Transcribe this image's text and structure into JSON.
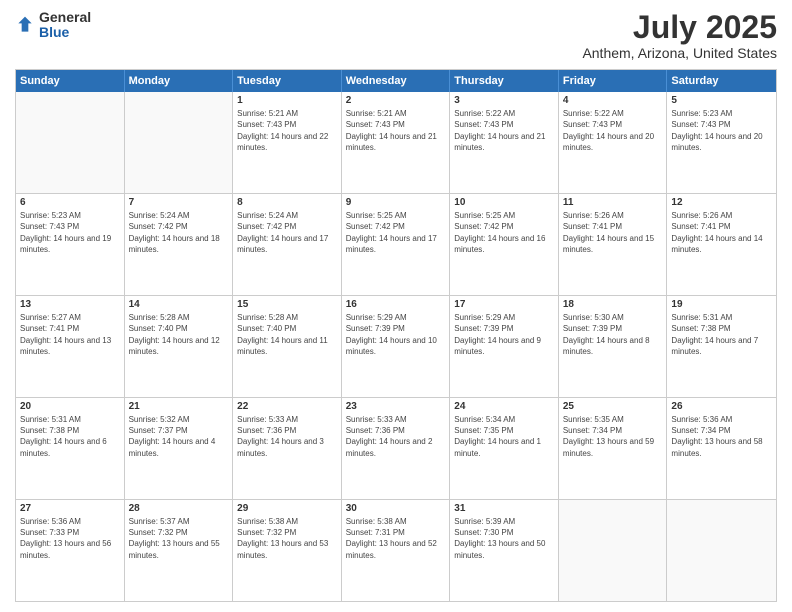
{
  "logo": {
    "general": "General",
    "blue": "Blue"
  },
  "title": "July 2025",
  "subtitle": "Anthem, Arizona, United States",
  "headers": [
    "Sunday",
    "Monday",
    "Tuesday",
    "Wednesday",
    "Thursday",
    "Friday",
    "Saturday"
  ],
  "weeks": [
    [
      {
        "day": "",
        "detail": ""
      },
      {
        "day": "",
        "detail": ""
      },
      {
        "day": "1",
        "detail": "Sunrise: 5:21 AM\nSunset: 7:43 PM\nDaylight: 14 hours and 22 minutes."
      },
      {
        "day": "2",
        "detail": "Sunrise: 5:21 AM\nSunset: 7:43 PM\nDaylight: 14 hours and 21 minutes."
      },
      {
        "day": "3",
        "detail": "Sunrise: 5:22 AM\nSunset: 7:43 PM\nDaylight: 14 hours and 21 minutes."
      },
      {
        "day": "4",
        "detail": "Sunrise: 5:22 AM\nSunset: 7:43 PM\nDaylight: 14 hours and 20 minutes."
      },
      {
        "day": "5",
        "detail": "Sunrise: 5:23 AM\nSunset: 7:43 PM\nDaylight: 14 hours and 20 minutes."
      }
    ],
    [
      {
        "day": "6",
        "detail": "Sunrise: 5:23 AM\nSunset: 7:43 PM\nDaylight: 14 hours and 19 minutes."
      },
      {
        "day": "7",
        "detail": "Sunrise: 5:24 AM\nSunset: 7:42 PM\nDaylight: 14 hours and 18 minutes."
      },
      {
        "day": "8",
        "detail": "Sunrise: 5:24 AM\nSunset: 7:42 PM\nDaylight: 14 hours and 17 minutes."
      },
      {
        "day": "9",
        "detail": "Sunrise: 5:25 AM\nSunset: 7:42 PM\nDaylight: 14 hours and 17 minutes."
      },
      {
        "day": "10",
        "detail": "Sunrise: 5:25 AM\nSunset: 7:42 PM\nDaylight: 14 hours and 16 minutes."
      },
      {
        "day": "11",
        "detail": "Sunrise: 5:26 AM\nSunset: 7:41 PM\nDaylight: 14 hours and 15 minutes."
      },
      {
        "day": "12",
        "detail": "Sunrise: 5:26 AM\nSunset: 7:41 PM\nDaylight: 14 hours and 14 minutes."
      }
    ],
    [
      {
        "day": "13",
        "detail": "Sunrise: 5:27 AM\nSunset: 7:41 PM\nDaylight: 14 hours and 13 minutes."
      },
      {
        "day": "14",
        "detail": "Sunrise: 5:28 AM\nSunset: 7:40 PM\nDaylight: 14 hours and 12 minutes."
      },
      {
        "day": "15",
        "detail": "Sunrise: 5:28 AM\nSunset: 7:40 PM\nDaylight: 14 hours and 11 minutes."
      },
      {
        "day": "16",
        "detail": "Sunrise: 5:29 AM\nSunset: 7:39 PM\nDaylight: 14 hours and 10 minutes."
      },
      {
        "day": "17",
        "detail": "Sunrise: 5:29 AM\nSunset: 7:39 PM\nDaylight: 14 hours and 9 minutes."
      },
      {
        "day": "18",
        "detail": "Sunrise: 5:30 AM\nSunset: 7:39 PM\nDaylight: 14 hours and 8 minutes."
      },
      {
        "day": "19",
        "detail": "Sunrise: 5:31 AM\nSunset: 7:38 PM\nDaylight: 14 hours and 7 minutes."
      }
    ],
    [
      {
        "day": "20",
        "detail": "Sunrise: 5:31 AM\nSunset: 7:38 PM\nDaylight: 14 hours and 6 minutes."
      },
      {
        "day": "21",
        "detail": "Sunrise: 5:32 AM\nSunset: 7:37 PM\nDaylight: 14 hours and 4 minutes."
      },
      {
        "day": "22",
        "detail": "Sunrise: 5:33 AM\nSunset: 7:36 PM\nDaylight: 14 hours and 3 minutes."
      },
      {
        "day": "23",
        "detail": "Sunrise: 5:33 AM\nSunset: 7:36 PM\nDaylight: 14 hours and 2 minutes."
      },
      {
        "day": "24",
        "detail": "Sunrise: 5:34 AM\nSunset: 7:35 PM\nDaylight: 14 hours and 1 minute."
      },
      {
        "day": "25",
        "detail": "Sunrise: 5:35 AM\nSunset: 7:34 PM\nDaylight: 13 hours and 59 minutes."
      },
      {
        "day": "26",
        "detail": "Sunrise: 5:36 AM\nSunset: 7:34 PM\nDaylight: 13 hours and 58 minutes."
      }
    ],
    [
      {
        "day": "27",
        "detail": "Sunrise: 5:36 AM\nSunset: 7:33 PM\nDaylight: 13 hours and 56 minutes."
      },
      {
        "day": "28",
        "detail": "Sunrise: 5:37 AM\nSunset: 7:32 PM\nDaylight: 13 hours and 55 minutes."
      },
      {
        "day": "29",
        "detail": "Sunrise: 5:38 AM\nSunset: 7:32 PM\nDaylight: 13 hours and 53 minutes."
      },
      {
        "day": "30",
        "detail": "Sunrise: 5:38 AM\nSunset: 7:31 PM\nDaylight: 13 hours and 52 minutes."
      },
      {
        "day": "31",
        "detail": "Sunrise: 5:39 AM\nSunset: 7:30 PM\nDaylight: 13 hours and 50 minutes."
      },
      {
        "day": "",
        "detail": ""
      },
      {
        "day": "",
        "detail": ""
      }
    ]
  ]
}
